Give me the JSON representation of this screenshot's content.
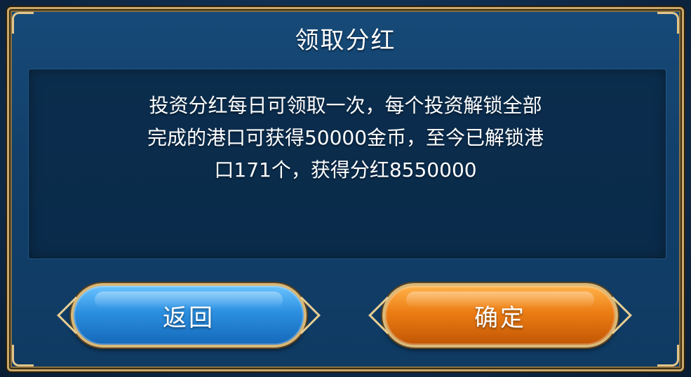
{
  "dialog": {
    "title": "领取分红",
    "message_lines": [
      "投资分红每日可领取一次，每个投资解锁全部",
      "完成的港口可获得50000金币，至今已解锁港",
      "口171个，获得分红8550000"
    ]
  },
  "buttons": {
    "back_label": "返回",
    "confirm_label": "确定"
  },
  "colors": {
    "panel_blue": "#12406b",
    "frame_gold": "#c9a86a",
    "back_button": "#2b8fe0",
    "confirm_button": "#ec7d14",
    "text": "#ffffff"
  }
}
